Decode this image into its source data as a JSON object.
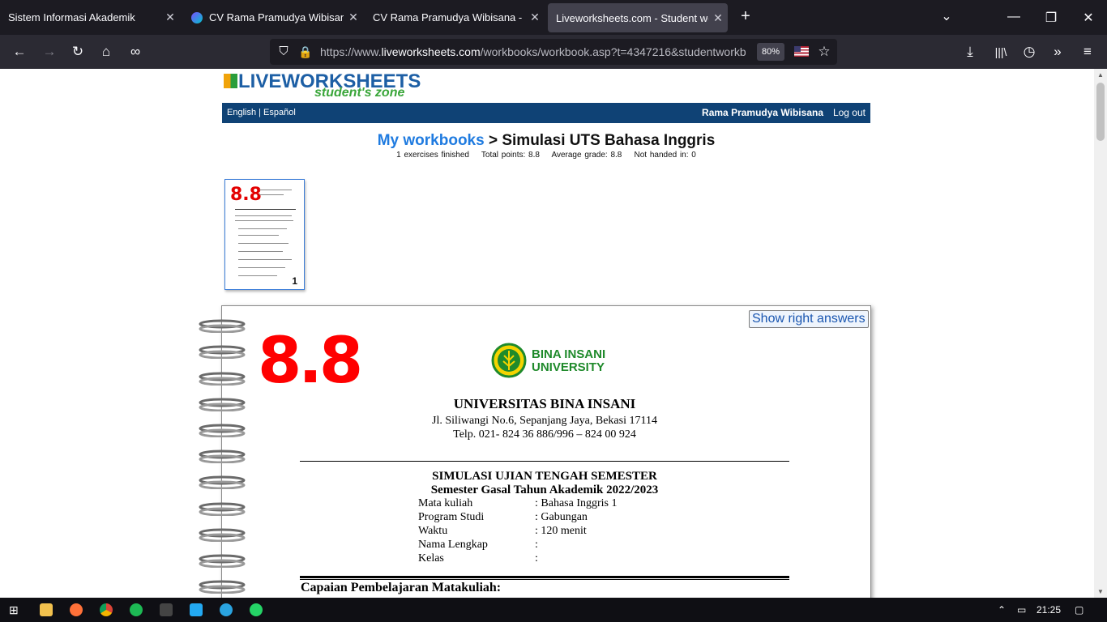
{
  "tabs": [
    {
      "label": "Sistem Informasi Akademik",
      "close": "✕"
    },
    {
      "label": "CV Rama Pramudya Wibisana -",
      "close": "✕"
    },
    {
      "label": "CV Rama Pramudya Wibisana - CV R",
      "close": "✕"
    },
    {
      "label": "Liveworksheets.com - Student work",
      "close": "✕"
    }
  ],
  "toolbar": {
    "new_tab": "+",
    "url_domain_prefix": "https://www.",
    "url_domain": "liveworksheets.com",
    "url_path": "/workbooks/workbook.asp?t=4347216&studentworkb",
    "zoom": "80%"
  },
  "site": {
    "logo": "LIVEWORKSHEETS",
    "logo_sub": "student's zone",
    "lang_links": "English  |  Español",
    "user_name": "Rama Pramudya Wibisana",
    "logout": "Log out"
  },
  "page": {
    "breadcrumb_link": "My workbooks",
    "breadcrumb_rest": " > Simulasi UTS Bahasa Inggris",
    "stats": "1 exercises finished    Total points: 8.8    Average grade: 8.8    Not handed in: 0",
    "thumb_grade": "8.8",
    "thumb_number": "1",
    "show_answers": "Show right answers",
    "grade": "8.8"
  },
  "document": {
    "uni_brand_line1": "BINA INSANI",
    "uni_brand_line2": "UNIVERSITY",
    "uni_title": "UNIVERSITAS BINA INSANI",
    "address": "Jl. Siliwangi No.6, Sepanjang Jaya, Bekasi 17114",
    "phone": "Telp. 021- 824 36 886/996 – 824 00 924",
    "exam_title": "SIMULASI UJIAN TENGAH SEMESTER",
    "semester": "Semester Gasal Tahun Akademik 2022/2023",
    "fields": [
      {
        "label": "Mata kuliah",
        "value": ":  Bahasa Inggris 1"
      },
      {
        "label": "Program Studi",
        "value": ": Gabungan"
      },
      {
        "label": "Waktu",
        "value": ": 120 menit"
      },
      {
        "label": "Nama Lengkap",
        "value": ":"
      },
      {
        "label": "Kelas",
        "value": ":"
      }
    ],
    "section_heading": "Capaian Pembelajaran Matakuliah:"
  },
  "taskbar": {
    "time": "21:25"
  },
  "colors": {
    "brand_blue": "#0f4275",
    "link_blue": "#1f7be0",
    "grade_red": "#ff0000",
    "uni_green": "#1f8a2b"
  }
}
